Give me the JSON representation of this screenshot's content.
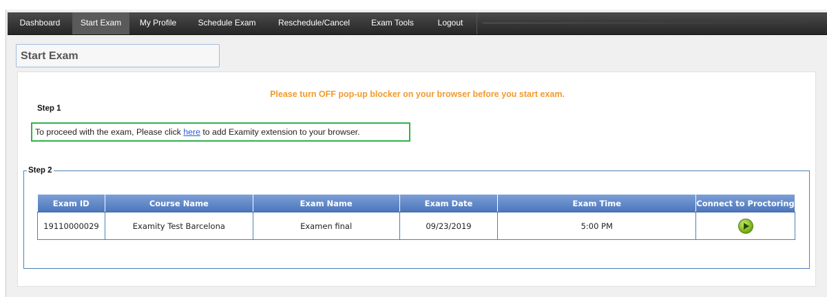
{
  "nav": {
    "items": [
      {
        "label": "Dashboard",
        "active": false
      },
      {
        "label": "Start Exam",
        "active": true
      },
      {
        "label": "My Profile",
        "active": false
      },
      {
        "label": "Schedule Exam",
        "active": false
      },
      {
        "label": "Reschedule/Cancel",
        "active": false
      },
      {
        "label": "Exam Tools",
        "active": false
      },
      {
        "label": "Logout",
        "active": false
      }
    ]
  },
  "page": {
    "title": "Start Exam",
    "warning": "Please turn OFF pop-up blocker on your browser before you start exam.",
    "step1_label": "Step 1",
    "notice_before": "To proceed with the exam, Please click ",
    "notice_link": "here",
    "notice_after": " to add Examity extension to your browser.",
    "step2_label": "Step 2"
  },
  "table": {
    "headers": [
      "Exam ID",
      "Course Name",
      "Exam Name",
      "Exam Date",
      "Exam Time",
      "Connect to Proctoring"
    ],
    "rows": [
      {
        "exam_id": "19110000029",
        "course_name": "Examity Test Barcelona",
        "exam_name": "Examen final",
        "exam_date": "09/23/2019",
        "exam_time": "5:00 PM",
        "connect_icon": "play-icon"
      }
    ]
  },
  "colors": {
    "warning": "#f39a2b",
    "highlight_border": "#2fb14a",
    "table_header": "#5b82c4",
    "nav_bg": "#333333"
  }
}
